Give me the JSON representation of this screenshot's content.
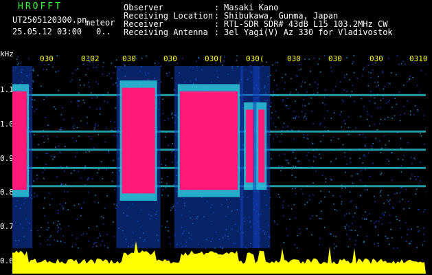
{
  "header": {
    "app_title": "HROFFT",
    "file_name": "UT2505120300.pn",
    "mode_label": "meteor",
    "date_time": "25.05.12 03:00",
    "extra": "0..",
    "fields": [
      {
        "label": "Observer",
        "value": "Masaki Kano"
      },
      {
        "label": "Receiving Location",
        "value": "Shibukawa, Gunma, Japan"
      },
      {
        "label": "Receiver",
        "value": "RTL-SDR SDR# 43dB L15 103.2MHz CW"
      },
      {
        "label": "Receiving Antenna",
        "value": "3el Yagi(V) Az 330 for Vladivostok"
      }
    ]
  },
  "axis": {
    "unit": "kHz",
    "y_ticks": [
      "1.1",
      "1.0",
      "0.9",
      "0.8",
      "0.7",
      "0.6"
    ],
    "time_ticks": [
      "030",
      "0302",
      "030",
      "030",
      "030(",
      "030(",
      "030",
      "030",
      "030",
      "0310"
    ]
  },
  "colors": {
    "header_title": "#3cff3c",
    "time_ticks": "#ffff00",
    "signal_strong": "#ff1a7a",
    "signal_mid": "#30d0e0",
    "signal_low": "#1040c0",
    "power_trace": "#ffff00",
    "background": "#000000"
  },
  "chart_data": {
    "type": "heatmap",
    "xlabel": "",
    "ylabel": "kHz",
    "ylim": [
      0.55,
      1.15
    ],
    "x_categories": [
      "030",
      "0302",
      "030",
      "030",
      "030(",
      "030(",
      "030",
      "030",
      "030",
      "0310"
    ],
    "y_ticks": [
      1.1,
      1.0,
      0.9,
      0.8,
      0.7,
      0.6
    ],
    "strong_bursts": [
      {
        "start_min": 0.0,
        "end_min": 0.35,
        "f_low": 0.78,
        "f_high": 1.05
      },
      {
        "start_min": 2.65,
        "end_min": 3.45,
        "f_low": 0.77,
        "f_high": 1.06
      },
      {
        "start_min": 4.05,
        "end_min": 5.45,
        "f_low": 0.78,
        "f_high": 1.05
      },
      {
        "start_min": 5.65,
        "end_min": 5.85,
        "f_low": 0.8,
        "f_high": 1.0
      },
      {
        "start_min": 5.95,
        "end_min": 6.1,
        "f_low": 0.8,
        "f_high": 1.0
      }
    ],
    "carrier_lines_khz": [
      1.04,
      0.94,
      0.89,
      0.84,
      0.79
    ]
  }
}
